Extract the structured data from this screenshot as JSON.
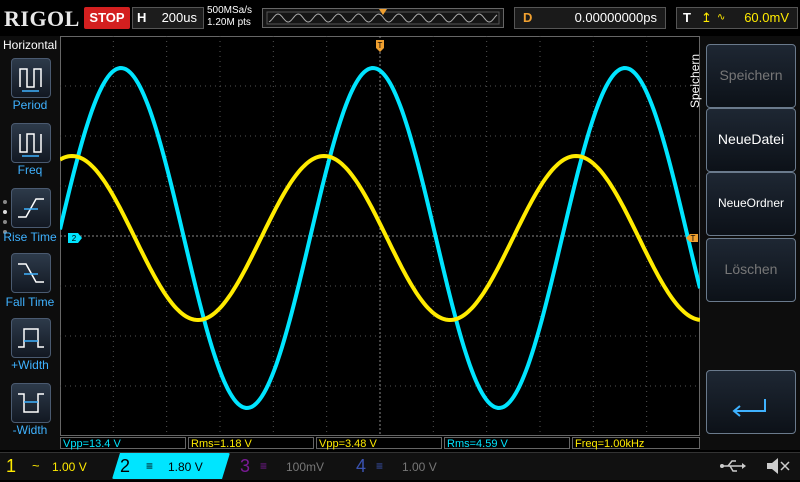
{
  "topbar": {
    "brand": "RIGOL",
    "run_state": "STOP",
    "horizontal": {
      "key": "H",
      "value": "200us"
    },
    "acquisition": {
      "sample_rate": "500MSa/s",
      "points": "1.20M pts"
    },
    "delay": {
      "key": "D",
      "value": "0.00000000ps"
    },
    "trigger": {
      "key": "T",
      "edge_icon": "rising-edge-icon",
      "source_icon": "signal-icon",
      "level": "60.0mV"
    }
  },
  "left_menu": {
    "title": "Horizontal",
    "items": [
      {
        "label": "Period",
        "icon": "period-icon"
      },
      {
        "label": "Freq",
        "icon": "frequency-icon"
      },
      {
        "label": "Rise Time",
        "icon": "rise-time-icon"
      },
      {
        "label": "Fall Time",
        "icon": "fall-time-icon"
      },
      {
        "label": "+Width",
        "icon": "positive-width-icon"
      },
      {
        "label": "-Width",
        "icon": "negative-width-icon"
      }
    ]
  },
  "right_menu": {
    "title": "Speichern",
    "items": [
      {
        "label": "Speichern",
        "enabled": false
      },
      {
        "label": "NeueDatei",
        "enabled": true
      },
      {
        "label": "NeueOrdner",
        "enabled": true
      },
      {
        "label": "Löschen",
        "enabled": false
      },
      {
        "label": "",
        "icon": "return-icon",
        "enabled": true
      }
    ]
  },
  "markers": {
    "trigger_position": "T",
    "channel2_ref": "2",
    "trigger_level": "T"
  },
  "measurements": [
    {
      "text": "Vpp=13.4 V",
      "color": "#00e5ff"
    },
    {
      "text": "Rms=1.18 V",
      "color": "#ffeb00"
    },
    {
      "text": "Vpp=3.48 V",
      "color": "#ffeb00"
    },
    {
      "text": "Rms=4.59 V",
      "color": "#00e5ff"
    },
    {
      "text": "Freq=1.00kHz",
      "color": "#ffeb00"
    }
  ],
  "channels": [
    {
      "num": "1",
      "coupling": "~",
      "scale": "1.00 V",
      "color": "#ffeb00",
      "active": true
    },
    {
      "num": "2",
      "coupling": "≡",
      "scale": "1.80 V",
      "color": "#00e5ff",
      "active": true,
      "selected": true
    },
    {
      "num": "3",
      "coupling": "≡",
      "scale": "100mV",
      "color": "#a000c8",
      "active": false
    },
    {
      "num": "4",
      "coupling": "≡",
      "scale": "1.00 V",
      "color": "#4a6cff",
      "active": false
    }
  ],
  "status_icons": [
    "usb-icon",
    "sound-muted-icon"
  ],
  "colors": {
    "ch1": "#ffeb00",
    "ch2": "#00e5ff",
    "stop": "#d31f1f",
    "delay": "#f0a030",
    "grid": "#555555"
  }
}
